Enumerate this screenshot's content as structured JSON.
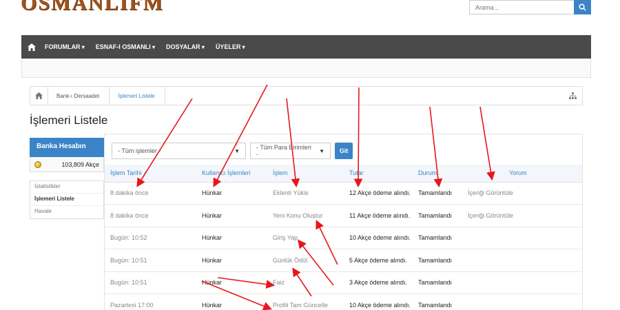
{
  "header": {
    "logo": "OSMANLIFM",
    "search_placeholder": "Arama..."
  },
  "nav": {
    "items": [
      "FORUMLAR",
      "ESNAF-I OSMANLI",
      "DOSYALAR",
      "ÜYELER"
    ]
  },
  "breadcrumb": {
    "items": [
      "Bank-ı Dersaadet",
      "İşlemeri Listele"
    ]
  },
  "page_title": "İşlemeri Listele",
  "sidebar": {
    "title": "Banka Hesabın",
    "balance": "103,809 Akçe",
    "links": [
      "İstatistikler",
      "İşlemeri Listele",
      "Havale"
    ]
  },
  "filters": {
    "type_select": "- Tüm işlemler -",
    "currency_select": "- Tüm Para Birimleri -",
    "go_label": "Git"
  },
  "table": {
    "headers": [
      "İşlem Tarihi ↓",
      "Kullanıcı İşlemleri",
      "İşlem",
      "Tutar",
      "Durum",
      "Yorum"
    ],
    "rows": [
      [
        "8 dakika önce",
        "Hünkar",
        "Eklenti Yükle",
        "12 Akçe ödeme alındı.",
        "Tamamlandı",
        "İçeriği Görüntüle"
      ],
      [
        "8 dakika önce",
        "Hünkar",
        "Yeni Konu Oluştur",
        "11 Akçe ödeme alındı.",
        "Tamamlandı",
        "İçeriği Görüntüle"
      ],
      [
        "Bugün: 10:52",
        "Hünkar",
        "Giriş Yap",
        "10 Akçe ödeme alındı.",
        "Tamamlandı",
        ""
      ],
      [
        "Bugün: 10:51",
        "Hünkar",
        "Günlük Ödül",
        "5 Akçe ödeme alındı.",
        "Tamamlandı",
        ""
      ],
      [
        "Bugün: 10:51",
        "Hünkar",
        "Faiz",
        "3 Akçe ödeme alındı.",
        "Tamamlandı",
        ""
      ],
      [
        "Pazartesi 17:00",
        "Hünkar",
        "Profili Tam Güncelle",
        "10 Akçe ödeme alındı.",
        "Tamamlandı",
        ""
      ]
    ]
  },
  "colors": {
    "accent": "#3a84c7",
    "navbar": "#4a4a4a",
    "annotation_arrow": "#e8161b"
  }
}
